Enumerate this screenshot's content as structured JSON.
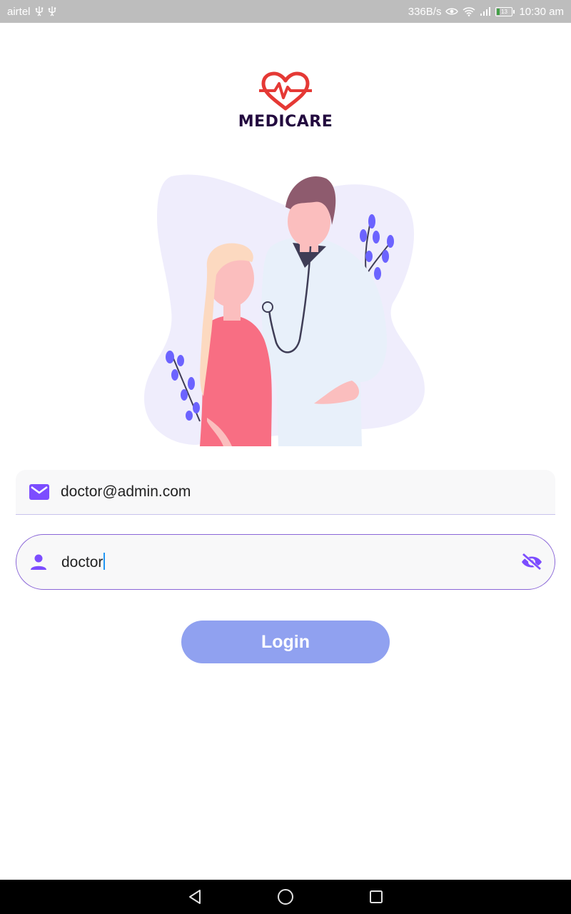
{
  "status_bar": {
    "carrier": "airtel",
    "net_speed": "336B/s",
    "battery_level": "13",
    "time": "10:30 am",
    "icons": [
      "usb-icon",
      "usb-icon",
      "eye-icon",
      "wifi-icon",
      "signal-icon",
      "battery-icon"
    ]
  },
  "app": {
    "brand": "MEDICARE"
  },
  "form": {
    "email": {
      "value": "doctor@admin.com",
      "icon": "mail-icon"
    },
    "password": {
      "value": "doctor",
      "icon": "person-icon",
      "toggle_icon": "visibility-off-icon"
    },
    "login_label": "Login"
  },
  "nav_bar": {
    "icons": [
      "back-icon",
      "home-icon",
      "recents-icon"
    ]
  },
  "colors": {
    "accent": "#7c4dff",
    "button": "#90a1f0",
    "brand_text": "#230a3f",
    "heart": "#e53935",
    "status_bar": "#bdbdbd"
  }
}
